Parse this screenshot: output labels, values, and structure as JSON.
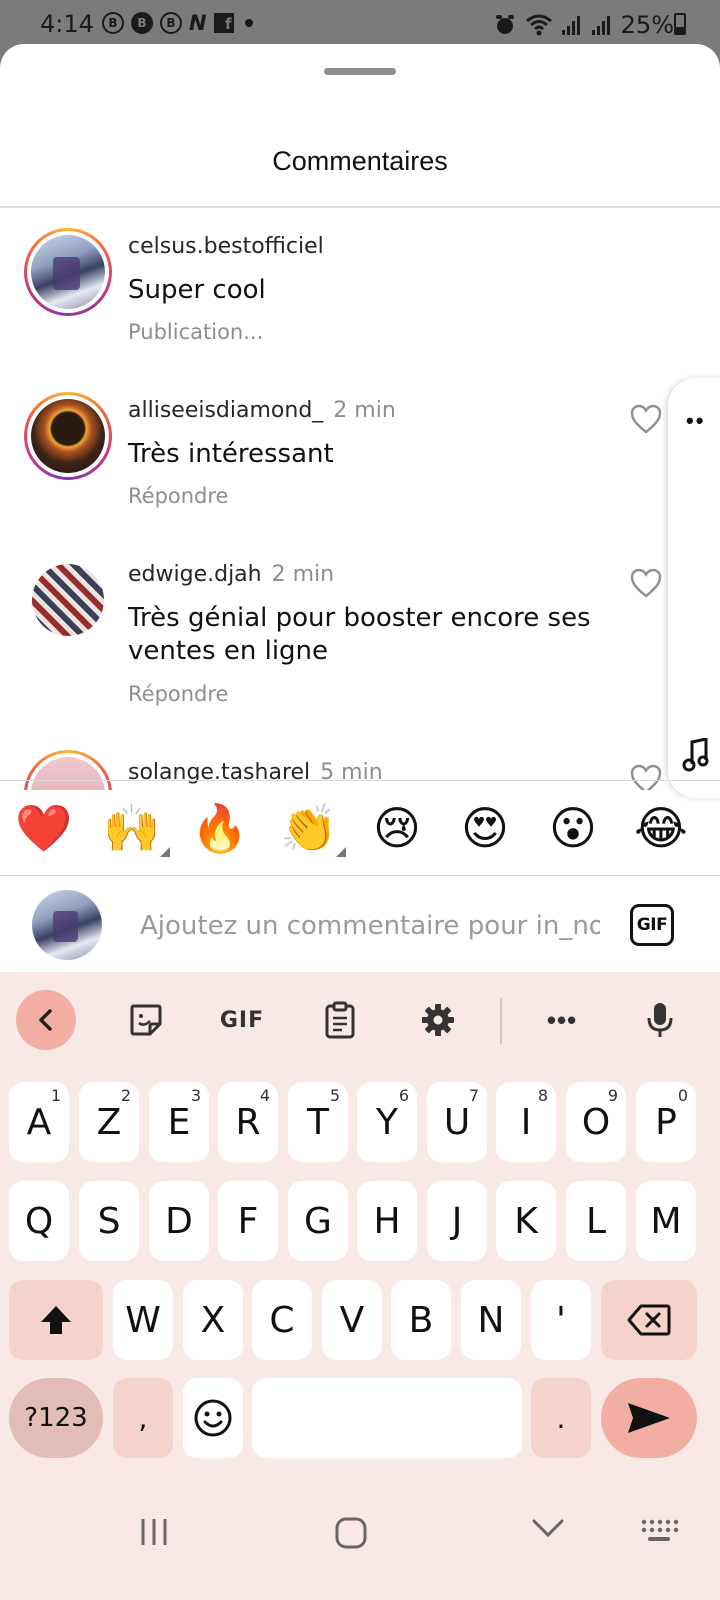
{
  "status_bar": {
    "time": "4:14",
    "notifications": [
      "B",
      "B",
      "B",
      "N",
      "f"
    ],
    "battery": "25%"
  },
  "sheet": {
    "title": "Commentaires"
  },
  "comments": [
    {
      "username": "celsus.bestofficiel",
      "time": "",
      "text": "Super cool",
      "action": "Publication..."
    },
    {
      "username": "alliseeisdiamond_",
      "time": "2 min",
      "text": "Très intéressant",
      "action": "Répondre"
    },
    {
      "username": "edwige.djah",
      "time": "2 min",
      "text": "Très génial pour booster encore ses ventes en ligne",
      "action": "Répondre"
    },
    {
      "username": "solange.tasharel",
      "time": "5 min",
      "text": "",
      "action": ""
    }
  ],
  "emoji_bar": [
    "❤️",
    "🙌",
    "🔥",
    "👏",
    "😢",
    "😍",
    "😮",
    "😂"
  ],
  "composer": {
    "placeholder": "Ajoutez un commentaire pour in_nova",
    "gif_label": "GIF"
  },
  "keyboard": {
    "toolbar_gif": "GIF",
    "row1": [
      {
        "label": "A",
        "hint": "1"
      },
      {
        "label": "Z",
        "hint": "2"
      },
      {
        "label": "E",
        "hint": "3"
      },
      {
        "label": "R",
        "hint": "4"
      },
      {
        "label": "T",
        "hint": "5"
      },
      {
        "label": "Y",
        "hint": "6"
      },
      {
        "label": "U",
        "hint": "7"
      },
      {
        "label": "I",
        "hint": "8"
      },
      {
        "label": "O",
        "hint": "9"
      },
      {
        "label": "P",
        "hint": "0"
      }
    ],
    "row2": [
      "Q",
      "S",
      "D",
      "F",
      "G",
      "H",
      "J",
      "K",
      "L",
      "M"
    ],
    "row3": [
      "W",
      "X",
      "C",
      "V",
      "B",
      "N",
      "'"
    ],
    "symbols_label": "?123",
    "comma": ",",
    "period": "."
  },
  "colors": {
    "keyboard_bg": "#f8e9e6",
    "accent_key": "#f3aea3",
    "story_ring": "#c13584"
  }
}
